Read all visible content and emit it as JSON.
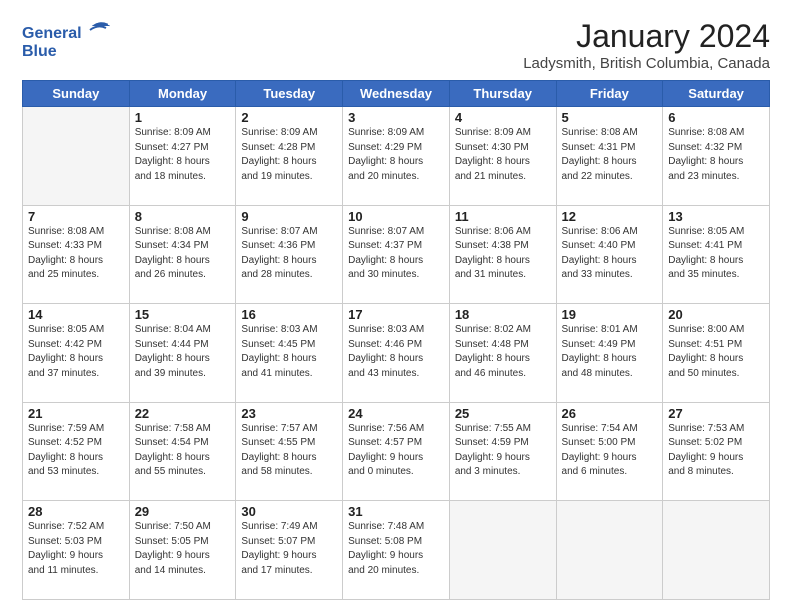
{
  "logo": {
    "line1": "General",
    "line2": "Blue"
  },
  "title": "January 2024",
  "subtitle": "Ladysmith, British Columbia, Canada",
  "days_of_week": [
    "Sunday",
    "Monday",
    "Tuesday",
    "Wednesday",
    "Thursday",
    "Friday",
    "Saturday"
  ],
  "weeks": [
    [
      {
        "day": "",
        "info": ""
      },
      {
        "day": "1",
        "info": "Sunrise: 8:09 AM\nSunset: 4:27 PM\nDaylight: 8 hours\nand 18 minutes."
      },
      {
        "day": "2",
        "info": "Sunrise: 8:09 AM\nSunset: 4:28 PM\nDaylight: 8 hours\nand 19 minutes."
      },
      {
        "day": "3",
        "info": "Sunrise: 8:09 AM\nSunset: 4:29 PM\nDaylight: 8 hours\nand 20 minutes."
      },
      {
        "day": "4",
        "info": "Sunrise: 8:09 AM\nSunset: 4:30 PM\nDaylight: 8 hours\nand 21 minutes."
      },
      {
        "day": "5",
        "info": "Sunrise: 8:08 AM\nSunset: 4:31 PM\nDaylight: 8 hours\nand 22 minutes."
      },
      {
        "day": "6",
        "info": "Sunrise: 8:08 AM\nSunset: 4:32 PM\nDaylight: 8 hours\nand 23 minutes."
      }
    ],
    [
      {
        "day": "7",
        "info": "Sunrise: 8:08 AM\nSunset: 4:33 PM\nDaylight: 8 hours\nand 25 minutes."
      },
      {
        "day": "8",
        "info": "Sunrise: 8:08 AM\nSunset: 4:34 PM\nDaylight: 8 hours\nand 26 minutes."
      },
      {
        "day": "9",
        "info": "Sunrise: 8:07 AM\nSunset: 4:36 PM\nDaylight: 8 hours\nand 28 minutes."
      },
      {
        "day": "10",
        "info": "Sunrise: 8:07 AM\nSunset: 4:37 PM\nDaylight: 8 hours\nand 30 minutes."
      },
      {
        "day": "11",
        "info": "Sunrise: 8:06 AM\nSunset: 4:38 PM\nDaylight: 8 hours\nand 31 minutes."
      },
      {
        "day": "12",
        "info": "Sunrise: 8:06 AM\nSunset: 4:40 PM\nDaylight: 8 hours\nand 33 minutes."
      },
      {
        "day": "13",
        "info": "Sunrise: 8:05 AM\nSunset: 4:41 PM\nDaylight: 8 hours\nand 35 minutes."
      }
    ],
    [
      {
        "day": "14",
        "info": "Sunrise: 8:05 AM\nSunset: 4:42 PM\nDaylight: 8 hours\nand 37 minutes."
      },
      {
        "day": "15",
        "info": "Sunrise: 8:04 AM\nSunset: 4:44 PM\nDaylight: 8 hours\nand 39 minutes."
      },
      {
        "day": "16",
        "info": "Sunrise: 8:03 AM\nSunset: 4:45 PM\nDaylight: 8 hours\nand 41 minutes."
      },
      {
        "day": "17",
        "info": "Sunrise: 8:03 AM\nSunset: 4:46 PM\nDaylight: 8 hours\nand 43 minutes."
      },
      {
        "day": "18",
        "info": "Sunrise: 8:02 AM\nSunset: 4:48 PM\nDaylight: 8 hours\nand 46 minutes."
      },
      {
        "day": "19",
        "info": "Sunrise: 8:01 AM\nSunset: 4:49 PM\nDaylight: 8 hours\nand 48 minutes."
      },
      {
        "day": "20",
        "info": "Sunrise: 8:00 AM\nSunset: 4:51 PM\nDaylight: 8 hours\nand 50 minutes."
      }
    ],
    [
      {
        "day": "21",
        "info": "Sunrise: 7:59 AM\nSunset: 4:52 PM\nDaylight: 8 hours\nand 53 minutes."
      },
      {
        "day": "22",
        "info": "Sunrise: 7:58 AM\nSunset: 4:54 PM\nDaylight: 8 hours\nand 55 minutes."
      },
      {
        "day": "23",
        "info": "Sunrise: 7:57 AM\nSunset: 4:55 PM\nDaylight: 8 hours\nand 58 minutes."
      },
      {
        "day": "24",
        "info": "Sunrise: 7:56 AM\nSunset: 4:57 PM\nDaylight: 9 hours\nand 0 minutes."
      },
      {
        "day": "25",
        "info": "Sunrise: 7:55 AM\nSunset: 4:59 PM\nDaylight: 9 hours\nand 3 minutes."
      },
      {
        "day": "26",
        "info": "Sunrise: 7:54 AM\nSunset: 5:00 PM\nDaylight: 9 hours\nand 6 minutes."
      },
      {
        "day": "27",
        "info": "Sunrise: 7:53 AM\nSunset: 5:02 PM\nDaylight: 9 hours\nand 8 minutes."
      }
    ],
    [
      {
        "day": "28",
        "info": "Sunrise: 7:52 AM\nSunset: 5:03 PM\nDaylight: 9 hours\nand 11 minutes."
      },
      {
        "day": "29",
        "info": "Sunrise: 7:50 AM\nSunset: 5:05 PM\nDaylight: 9 hours\nand 14 minutes."
      },
      {
        "day": "30",
        "info": "Sunrise: 7:49 AM\nSunset: 5:07 PM\nDaylight: 9 hours\nand 17 minutes."
      },
      {
        "day": "31",
        "info": "Sunrise: 7:48 AM\nSunset: 5:08 PM\nDaylight: 9 hours\nand 20 minutes."
      },
      {
        "day": "",
        "info": ""
      },
      {
        "day": "",
        "info": ""
      },
      {
        "day": "",
        "info": ""
      }
    ]
  ]
}
